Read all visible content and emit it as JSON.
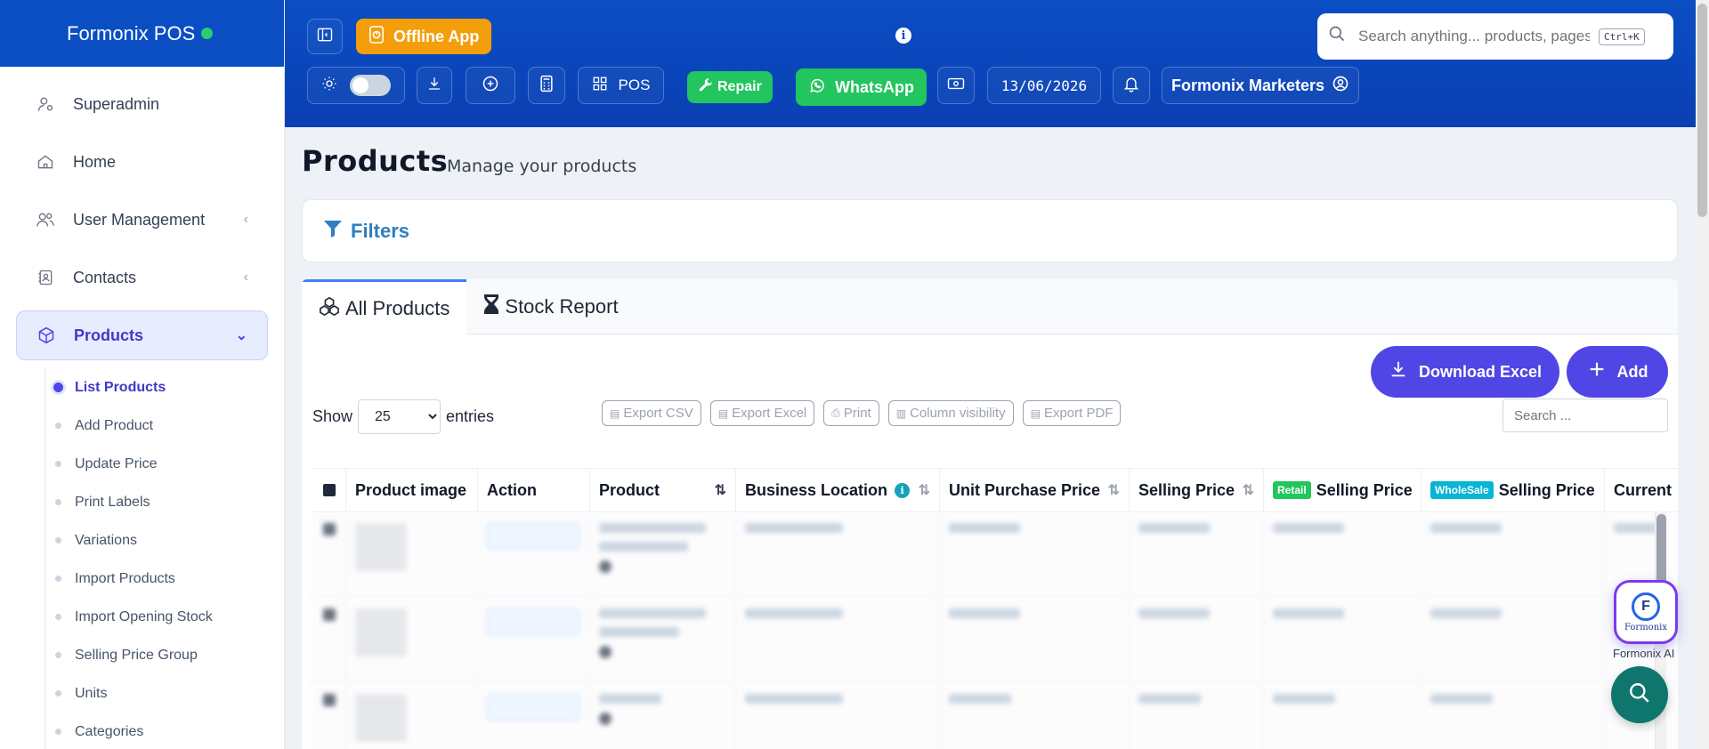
{
  "brand": {
    "name": "Formonix POS"
  },
  "sidebar": {
    "items": [
      {
        "label": "Superadmin"
      },
      {
        "label": "Home"
      },
      {
        "label": "User Management"
      },
      {
        "label": "Contacts"
      },
      {
        "label": "Products"
      }
    ],
    "products_sub": [
      {
        "label": "List Products"
      },
      {
        "label": "Add Product"
      },
      {
        "label": "Update Price"
      },
      {
        "label": "Print Labels"
      },
      {
        "label": "Variations"
      },
      {
        "label": "Import Products"
      },
      {
        "label": "Import Opening Stock"
      },
      {
        "label": "Selling Price Group"
      },
      {
        "label": "Units"
      },
      {
        "label": "Categories"
      }
    ]
  },
  "header": {
    "offline_label": "Offline App",
    "pos_label": "POS",
    "repair_label": "Repair",
    "whatsapp_label": "WhatsApp",
    "date": "13/06/2026",
    "business_label": "Formonix Marketers",
    "search_placeholder": "Search anything... products, pages",
    "search_shortcut": "Ctrl+K"
  },
  "page": {
    "title": "Products",
    "subtitle": "Manage your products",
    "filters_label": "Filters"
  },
  "tabs": [
    {
      "label": "All Products"
    },
    {
      "label": "Stock Report"
    }
  ],
  "actions": {
    "download_label": "Download Excel",
    "add_label": "Add"
  },
  "table_controls": {
    "show_label": "Show",
    "entries_label": "entries",
    "page_size": "25",
    "search_placeholder": "Search ...",
    "exports": [
      "Export CSV",
      "Export Excel",
      "Print",
      "Column visibility",
      "Export PDF"
    ]
  },
  "table": {
    "columns": {
      "image": "Product image",
      "action": "Action",
      "product": "Product",
      "location": "Business Location",
      "unit_price": "Unit Purchase Price",
      "selling": "Selling Price",
      "retail_badge": "Retail",
      "retail_selling": "Selling Price",
      "wholesale_badge": "WholeSale",
      "wholesale_selling": "Selling Price",
      "current": "Current"
    }
  },
  "widgets": {
    "ai_brand": "Formonix",
    "ai_label": "Formonix AI"
  },
  "colors": {
    "header_blue": "#0b4ec4",
    "accent_indigo": "#4f46e5",
    "offline_orange": "#f59e0b",
    "whatsapp_green": "#22c55e",
    "filter_blue": "#2f7fc1",
    "retail_badge": "#22c55e",
    "wholesale_badge": "#06b6d4",
    "fab_teal": "#0f766e"
  }
}
